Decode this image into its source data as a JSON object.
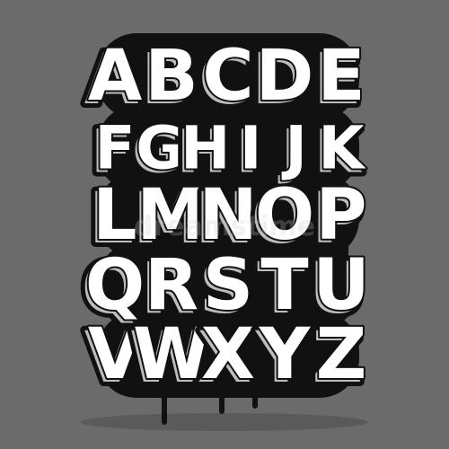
{
  "colors": {
    "background": "#6b6b6b",
    "letter_fill": "#ffffff",
    "outline": "#111111",
    "shade": "#bdbdbd",
    "shadow": "#4a4a4a"
  },
  "alphabet_rows": [
    [
      "A",
      "B",
      "C",
      "D",
      "E"
    ],
    [
      "F",
      "G",
      "H",
      "I",
      "J",
      "K"
    ],
    [
      "L",
      "M",
      "N",
      "O",
      "P"
    ],
    [
      "Q",
      "R",
      "S",
      "T",
      "U"
    ],
    [
      "V",
      "W",
      "X",
      "Y",
      "Z"
    ]
  ],
  "watermark_text": "dreamstime"
}
